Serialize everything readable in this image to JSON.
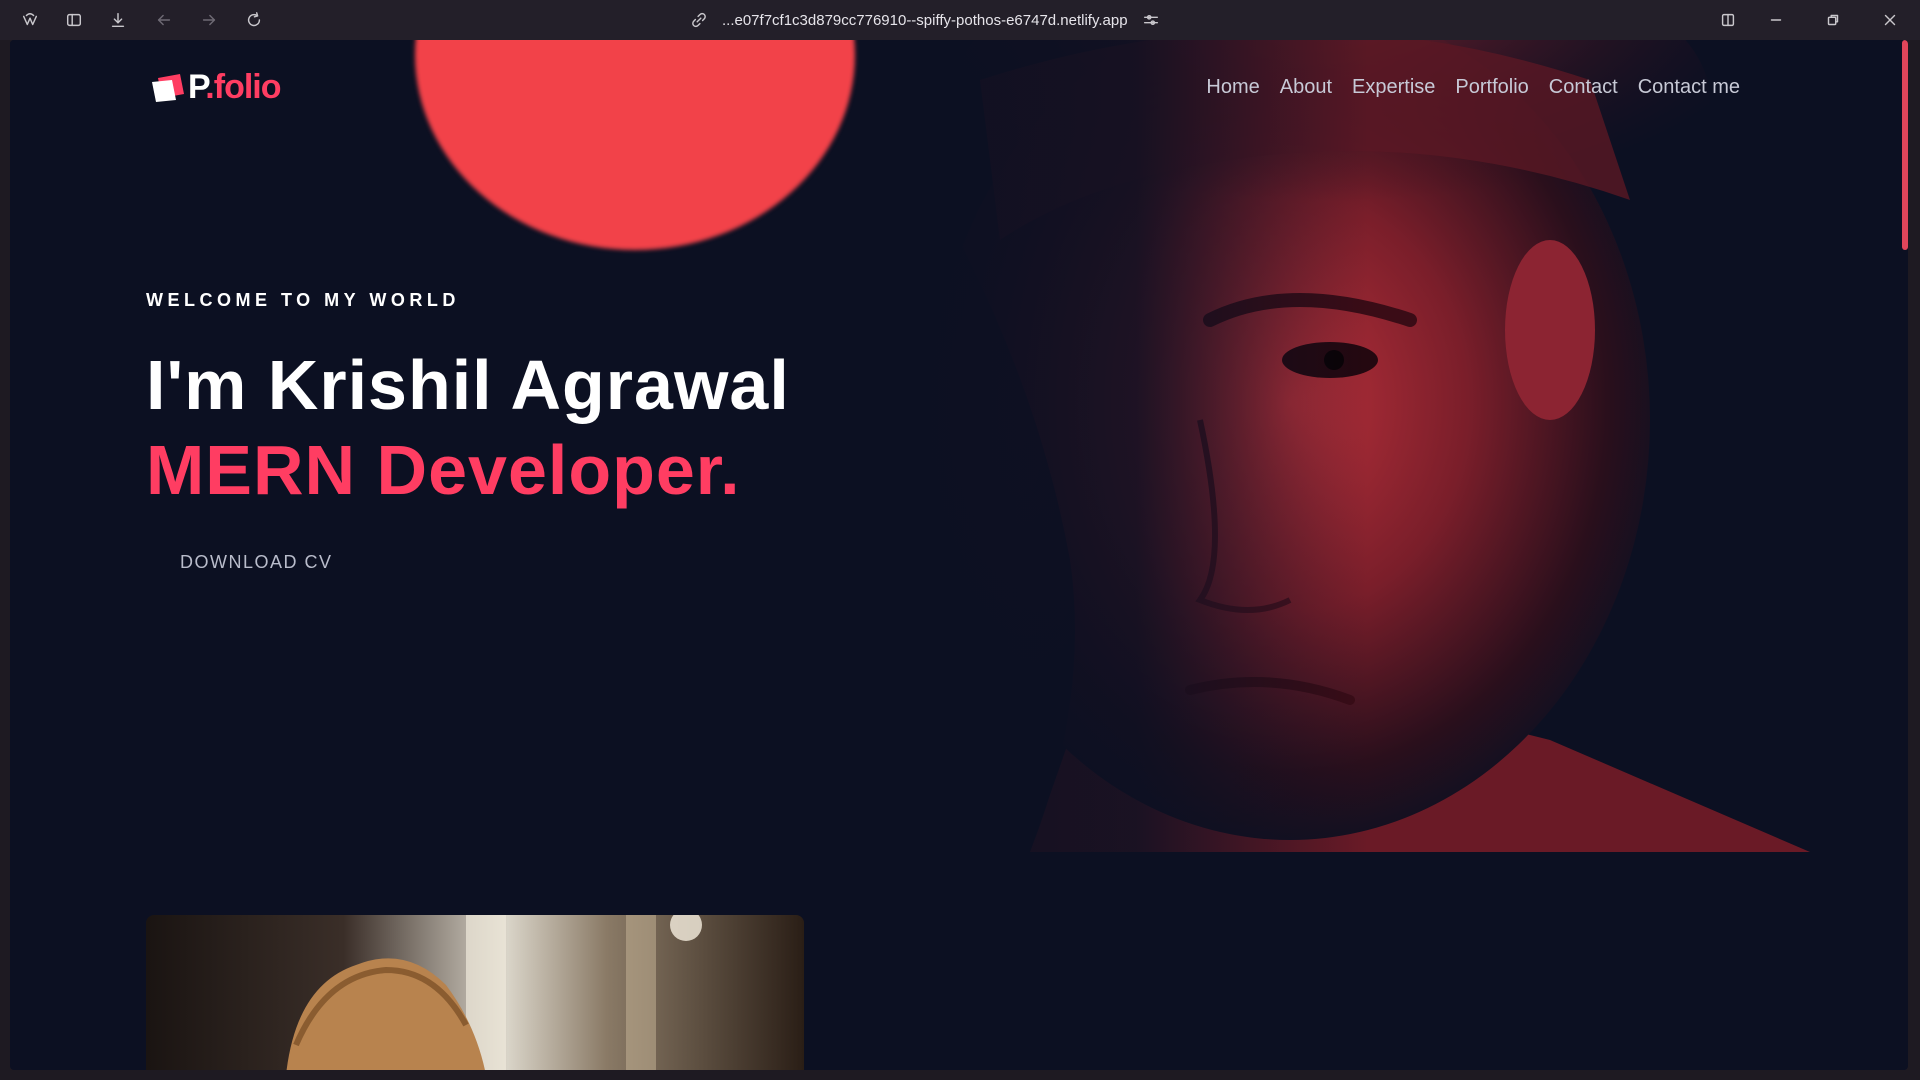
{
  "browser": {
    "url": "...e07f7cf1c3d879cc776910--spiffy-pothos-e6747d.netlify.app"
  },
  "nav": {
    "logo_prefix": "P",
    "logo_suffix": ".folio",
    "links": [
      "Home",
      "About",
      "Expertise",
      "Portfolio",
      "Contact",
      "Contact me"
    ]
  },
  "hero": {
    "welcome": "WELCOME TO MY WORLD",
    "name": "I'm Krishil Agrawal",
    "role": "MERN Developer.",
    "cta": "DOWNLOAD CV"
  },
  "colors": {
    "accent": "#ff3d62",
    "background": "#0c1022",
    "circle": "#f24249"
  },
  "icons": [
    "app-logo-icon",
    "sidebar-icon",
    "download-icon",
    "back-icon",
    "forward-icon",
    "reload-icon",
    "link-icon",
    "settings-icon",
    "split-view-icon",
    "minimize-icon",
    "restore-icon",
    "close-icon"
  ]
}
